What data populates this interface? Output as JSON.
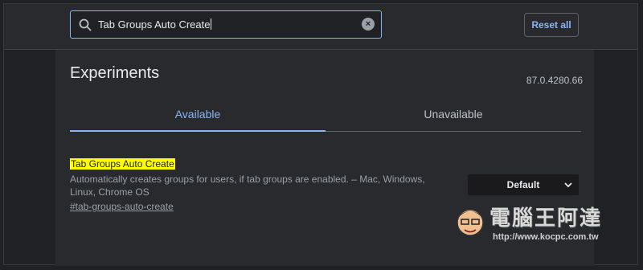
{
  "search": {
    "value": "Tab Groups Auto Create"
  },
  "header": {
    "reset_label": "Reset all"
  },
  "page": {
    "title": "Experiments",
    "version": "87.0.4280.66"
  },
  "tabs": [
    {
      "label": "Available",
      "active": true
    },
    {
      "label": "Unavailable",
      "active": false
    }
  ],
  "experiment": {
    "title": "Tab Groups Auto Create",
    "description": "Automatically creates groups for users, if tab groups are enabled. – Mac, Windows, Linux, Chrome OS",
    "link": "#tab-groups-auto-create",
    "selected": "Default"
  },
  "watermark": {
    "name": "電腦王阿達",
    "url": "http://www.kocpc.com.tw"
  },
  "colors": {
    "accent": "#8ab4f8",
    "highlight": "#ffff00",
    "background": "#202124",
    "panel": "#292a2d"
  }
}
